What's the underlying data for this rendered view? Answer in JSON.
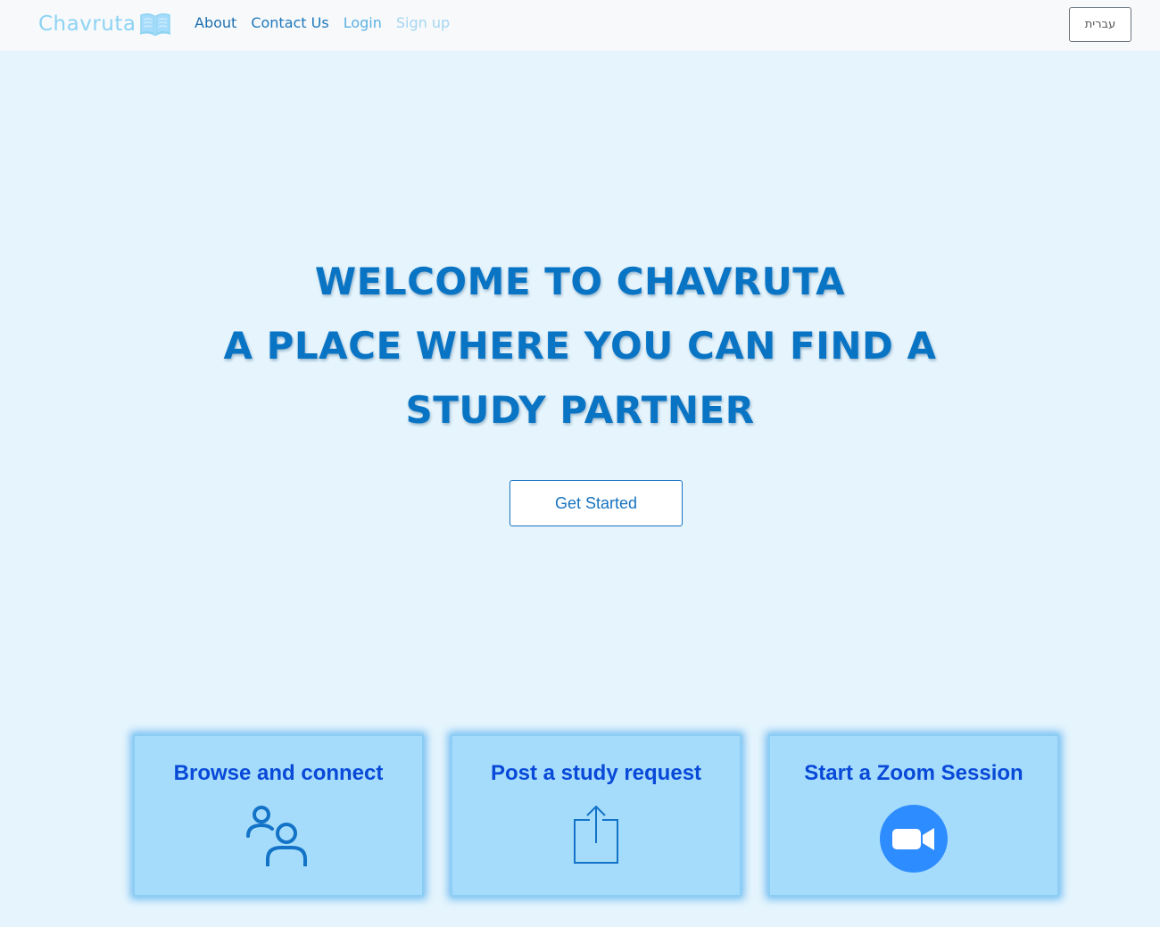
{
  "navbar": {
    "brand": "Chavruta",
    "links": [
      "About",
      "Contact Us",
      "Login",
      "Sign up"
    ],
    "language_button": "עברית"
  },
  "hero": {
    "line1": "WELCOME TO CHAVRUTA",
    "line2": "A PLACE WHERE YOU CAN FIND A",
    "line3": "STUDY PARTNER",
    "cta": "Get Started"
  },
  "cards": [
    {
      "title": "Browse and connect",
      "icon": "users-icon"
    },
    {
      "title": "Post a study request",
      "icon": "share-upload-icon"
    },
    {
      "title": "Start a Zoom Session",
      "icon": "zoom-video-icon"
    }
  ],
  "colors": {
    "background": "#e6f5fd",
    "navbar": "#f7f9fb",
    "brand": "#8dd3f3",
    "hero_text": "#0a74c4",
    "card_fill": "#a6dcfb",
    "card_title": "#0849d8",
    "zoom_blue": "#2d8cff"
  }
}
